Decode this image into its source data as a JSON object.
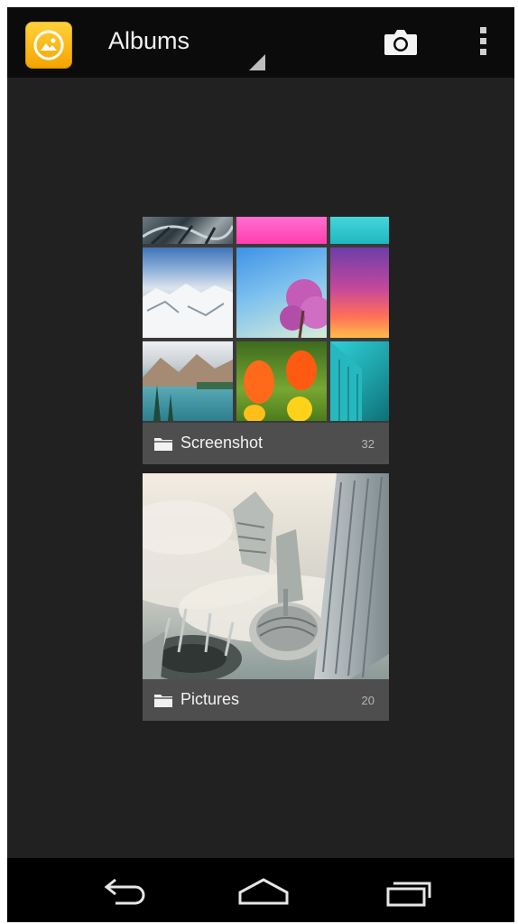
{
  "action_bar": {
    "title": "Albums",
    "app_icon": "gallery-app-icon",
    "actions": [
      {
        "name": "camera",
        "icon": "camera-icon"
      },
      {
        "name": "overflow-menu",
        "icon": "more-vert-icon"
      }
    ]
  },
  "albums": [
    {
      "name": "Screenshot",
      "count": "32",
      "icon": "folder-icon"
    },
    {
      "name": "Pictures",
      "count": "20",
      "icon": "folder-icon"
    }
  ],
  "nav_bar": {
    "buttons": [
      {
        "name": "back",
        "icon": "back-icon"
      },
      {
        "name": "home",
        "icon": "home-icon"
      },
      {
        "name": "recents",
        "icon": "recents-icon"
      }
    ]
  },
  "colors": {
    "background": "#212121",
    "action_bar": "#0b0b0b",
    "nav_bar": "#000000",
    "app_icon": "#f4a400"
  }
}
